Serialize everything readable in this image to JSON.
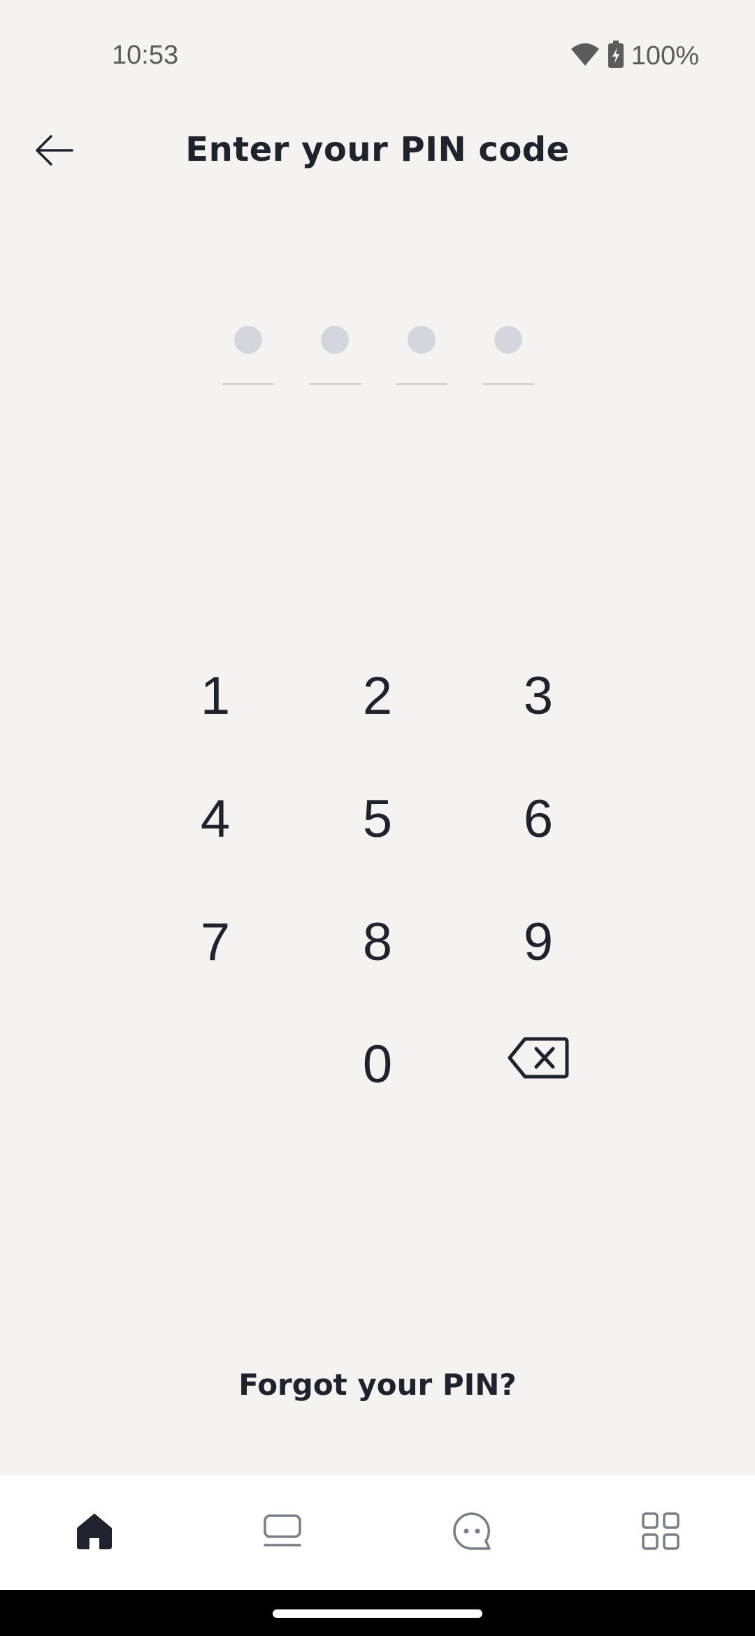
{
  "status_bar": {
    "time": "10:53",
    "battery_percent": "100%",
    "icons": [
      "wifi-icon",
      "battery-charging-icon"
    ]
  },
  "header": {
    "back_icon": "arrow-left-icon",
    "title": "Enter your PIN code"
  },
  "pin": {
    "length": 4,
    "entered": 0
  },
  "keypad": {
    "keys": [
      "1",
      "2",
      "3",
      "4",
      "5",
      "6",
      "7",
      "8",
      "9",
      "0"
    ],
    "backspace_icon": "backspace-icon"
  },
  "forgot_pin": "Forgot your PIN?",
  "bottom_nav": {
    "items": [
      {
        "icon": "home-icon",
        "active": true
      },
      {
        "icon": "card-icon",
        "active": false
      },
      {
        "icon": "chat-icon",
        "active": false
      },
      {
        "icon": "grid-icon",
        "active": false
      }
    ]
  },
  "colors": {
    "background": "#f4f3f2",
    "text": "#20222e",
    "pin_dot": "#d3d6dc",
    "nav_active": "#20222e",
    "nav_inactive": "#7a7d87"
  }
}
